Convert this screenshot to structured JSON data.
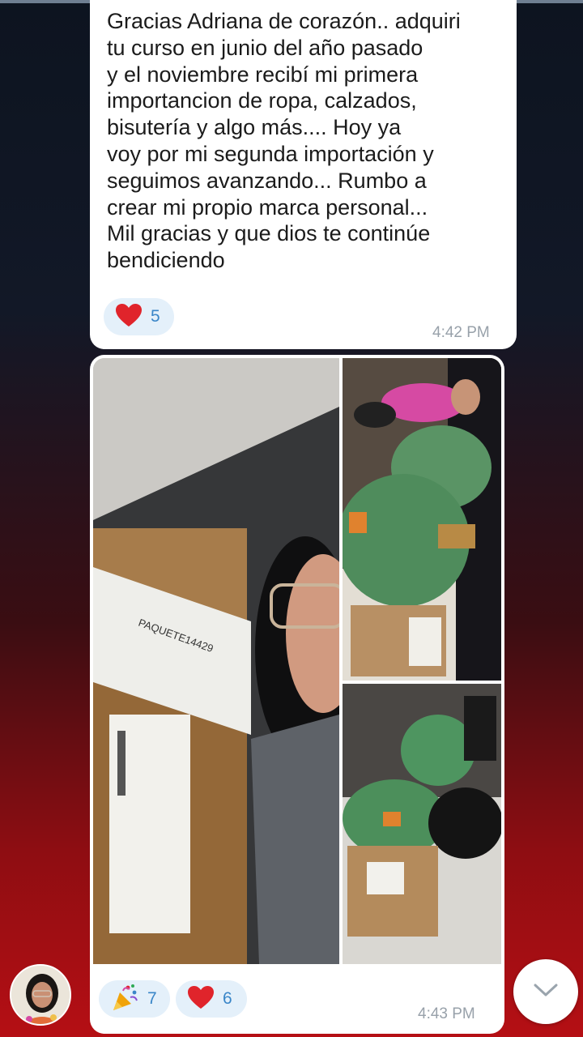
{
  "messages": [
    {
      "text": "Gracias Adriana de corazón.. adquiri\ntu curso en junio del año pasado\ny el noviembre recibí mi primera\nimportancion de ropa, calzados,\nbisutería y algo más.... Hoy ya\nvoy por mi segunda importación y\nseguimos avanzando... Rumbo a\ncrear mi propio marca personal...\nMil gracias y que dios te continúe\nbendiciendo",
      "reactions": [
        {
          "icon": "heart-icon",
          "count": "5"
        }
      ],
      "time": "4:42 PM"
    },
    {
      "album": [
        {
          "name": "photo-selfie-with-box",
          "box_label": "PAQUETE14429"
        },
        {
          "name": "photo-woman-with-green-packages"
        },
        {
          "name": "photo-packages-on-floor"
        }
      ],
      "reactions": [
        {
          "icon": "party-popper-icon",
          "count": "7"
        },
        {
          "icon": "heart-icon",
          "count": "6"
        }
      ],
      "time": "4:43 PM"
    }
  ],
  "colors": {
    "heart": "#e0242b",
    "reaction_bg": "#e4f0fa",
    "reaction_count": "#3a86c8",
    "time": "#98a1aa"
  },
  "scroll_button": {
    "icon": "chevron-down-icon"
  }
}
